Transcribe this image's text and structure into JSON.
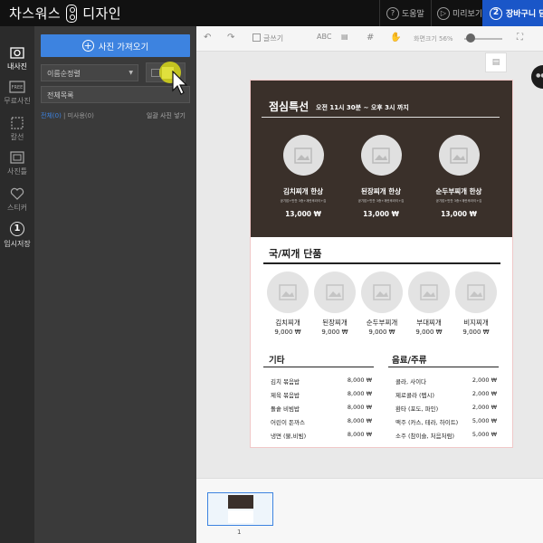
{
  "topbar": {
    "brand_left": "차스워스",
    "brand_right": "디자인",
    "help": "도움말",
    "preview": "미리보기",
    "cart_step": "2",
    "cart_label": "장바구니 담기"
  },
  "sidebar": {
    "items": [
      {
        "label": "내사진",
        "icon": "photo-icon"
      },
      {
        "label": "무료사진",
        "icon": "free-photo-icon"
      },
      {
        "label": "칼선",
        "icon": "cut-line-icon"
      },
      {
        "label": "사진틀",
        "icon": "photo-frame-icon"
      },
      {
        "label": "스티커",
        "icon": "heart-icon"
      },
      {
        "label": "임시저장",
        "icon": "temp-save-icon",
        "badge": "1"
      }
    ]
  },
  "panel": {
    "add_photo_label": "사진 가져오기",
    "sort_value": "이름순정렬",
    "folder_value": "전체목록",
    "filter_all": "전체(0)",
    "filter_sep": " | ",
    "filter_used": "미사용(0)",
    "hide_used": "일괄 사진 넣기"
  },
  "toolbar": {
    "text_label": "글쓰기",
    "zoom_label": "화면크기 56%"
  },
  "menu": {
    "special": {
      "title": "점심특선",
      "time": "오전 11시 30분 ~ 오후 3시 까지",
      "items": [
        {
          "name": "김치찌개 한상",
          "desc": "공기밥+반찬 3종+계란후라이+김",
          "price": "13,000 ₩"
        },
        {
          "name": "된장찌개 한상",
          "desc": "공기밥+반찬 3종+계란후라이+김",
          "price": "13,000 ₩"
        },
        {
          "name": "순두부찌개 한상",
          "desc": "공기밥+반찬 3종+계란후라이+김",
          "price": "13,000 ₩"
        }
      ]
    },
    "soups": {
      "title": "국/찌개 단품",
      "items": [
        {
          "name": "김치찌개",
          "price": "9,000 ₩"
        },
        {
          "name": "된장찌개",
          "price": "9,000 ₩"
        },
        {
          "name": "순두부찌개",
          "price": "9,000 ₩"
        },
        {
          "name": "부대찌개",
          "price": "9,000 ₩"
        },
        {
          "name": "비지찌개",
          "price": "9,000 ₩"
        }
      ]
    },
    "etc": {
      "title": "기타",
      "items": [
        {
          "name": "김치 볶음밥",
          "price": "8,000 ₩"
        },
        {
          "name": "제육 볶음밥",
          "price": "8,000 ₩"
        },
        {
          "name": "돌솥 비빔밥",
          "price": "8,000 ₩"
        },
        {
          "name": "어린이 돈까스",
          "price": "8,000 ₩"
        },
        {
          "name": "냉면 (물,비빔)",
          "price": "8,000 ₩"
        }
      ]
    },
    "drinks": {
      "title": "음료/주류",
      "items": [
        {
          "name": "콜라, 사이다",
          "price": "2,000 ₩"
        },
        {
          "name": "제로콜라 (펩시)",
          "price": "2,000 ₩"
        },
        {
          "name": "환타 (포도, 파인)",
          "price": "2,000 ₩"
        },
        {
          "name": "맥주 (카스, 테라, 하이트)",
          "price": "5,000 ₩"
        },
        {
          "name": "소주 (참이슬, 처음처럼)",
          "price": "5,000 ₩"
        }
      ]
    }
  },
  "pages": {
    "current": "1"
  },
  "colors": {
    "accent": "#3d83e0",
    "cart": "#1a56c8",
    "menu_dark": "#3a302a",
    "highlight": "#e6e614"
  }
}
